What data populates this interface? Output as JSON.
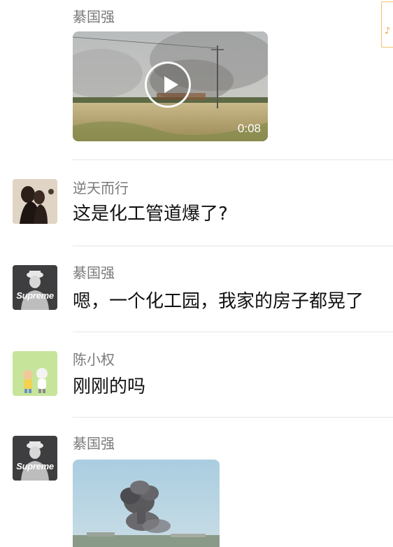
{
  "messages": [
    {
      "name": "綦国强",
      "video_duration": "0:08"
    },
    {
      "name": "逆天而行",
      "text": "这是化工管道爆了?"
    },
    {
      "name": "綦国强",
      "text": "嗯，一个化工园，我家的房子都晃了"
    },
    {
      "name": "陈小权",
      "text": "刚刚的吗"
    },
    {
      "name": "綦国强",
      "avatar_label": "Supreme"
    }
  ],
  "avatars": {
    "qi_guoqiang_label": "Supreme"
  },
  "edge_tag_glyph": "♪",
  "colors": {
    "name_gray": "#7a7a7a",
    "message_black": "#111111",
    "divider": "#e6e6e6",
    "tag_orange": "#e8a12c"
  }
}
